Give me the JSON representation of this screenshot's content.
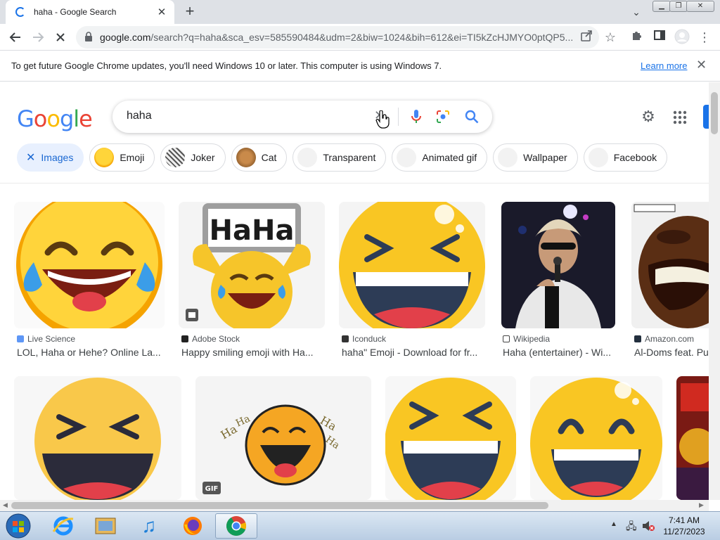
{
  "browser": {
    "tab_title": "haha - Google Search",
    "url_host": "google.com",
    "url_rest": "/search?q=haha&sca_esv=585590484&udm=2&biw=1024&bih=612&ei=TI5kZcHJMYO0ptQP5...",
    "info_message": "To get future Google Chrome updates, you'll need Windows 10 or later. This computer is using Windows 7.",
    "info_link": "Learn more"
  },
  "search": {
    "query": "haha",
    "logo": "Google"
  },
  "chips": [
    {
      "label": "Images",
      "active": true
    },
    {
      "label": "Emoji"
    },
    {
      "label": "Joker"
    },
    {
      "label": "Cat"
    },
    {
      "label": "Transparent"
    },
    {
      "label": "Animated gif"
    },
    {
      "label": "Wallpaper"
    },
    {
      "label": "Facebook"
    }
  ],
  "results_row1": [
    {
      "source": "Live Science",
      "caption": "LOL, Haha or Hehe? Online La..."
    },
    {
      "source": "Adobe Stock",
      "caption": "Happy smiling emoji with Ha..."
    },
    {
      "source": "Iconduck",
      "caption": "haha\" Emoji - Download for fr..."
    },
    {
      "source": "Wikipedia",
      "caption": "Haha (entertainer) - Wi..."
    },
    {
      "source": "Amazon.com",
      "caption": "Al-Doms feat. Pu..."
    }
  ],
  "image_text": {
    "haha_sign": "HaHa",
    "haha_sound": "Ha",
    "gif_badge": "GIF"
  },
  "taskbar": {
    "time": "7:41 AM",
    "date": "11/27/2023"
  },
  "colors": {
    "accent": "#1a73e8",
    "chip_active_bg": "#e8f0fe",
    "emoji_yellow": "#f9c623"
  }
}
